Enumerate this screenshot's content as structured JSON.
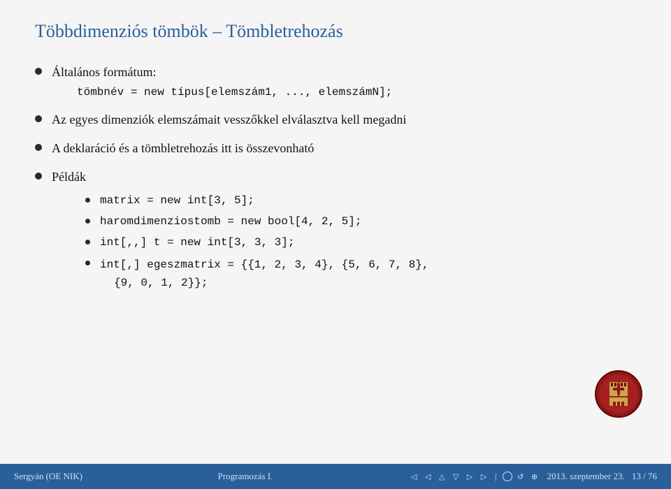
{
  "slide": {
    "title": "Többdimenziós tömbök – Tömbletrehozás",
    "bullets": [
      {
        "id": "general-format",
        "text": "Általános formátum:",
        "sub_text": "tömbnév = new típus[elemszám1, ..., elemszámN];",
        "has_code_sub": true
      },
      {
        "id": "dimensions",
        "text": "Az egyes dimenziók elemszámait vesszőkkel elválasztva kell megadni"
      },
      {
        "id": "declaration",
        "text": "A deklaráció és a tömbletrehozás itt is összevonható"
      },
      {
        "id": "examples",
        "text": "Példák",
        "examples": [
          "matrix = new int[3, 5];",
          "haromdimenziostomb = new bool[4, 2, 5];",
          "int[,,] t = new int[3, 3, 3];",
          "int[,] egeszmatrix = {{1, 2, 3, 4}, {5, 6, 7, 8},",
          "{9, 0, 1, 2}};"
        ]
      }
    ]
  },
  "footer": {
    "left": "Sergyán  (OE NIK)",
    "center": "Programozás I.",
    "right_date": "2013. szeptember 23.",
    "right_page": "13 / 76"
  },
  "icons": {
    "nav_left1": "◁",
    "nav_left2": "◁",
    "nav_right1": "▷",
    "nav_right2": "▷",
    "nav_up1": "△",
    "nav_up2": "△",
    "nav_down1": "▽",
    "refresh": "↺",
    "search": "⊕"
  }
}
